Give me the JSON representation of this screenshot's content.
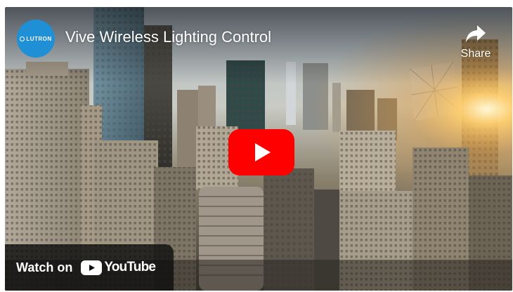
{
  "player": {
    "channel_name": "LUTRON",
    "title": "Vive Wireless Lighting Control",
    "share_label": "Share",
    "watch_on_label": "Watch on",
    "youtube_label": "YouTube",
    "icons": {
      "share": "share-arrow-icon",
      "play": "youtube-play-icon",
      "logo": "youtube-logo-icon"
    },
    "colors": {
      "play_button": "#ff0000",
      "avatar": "#1f8fd6",
      "watch_bar": "#0f0f0f"
    }
  }
}
